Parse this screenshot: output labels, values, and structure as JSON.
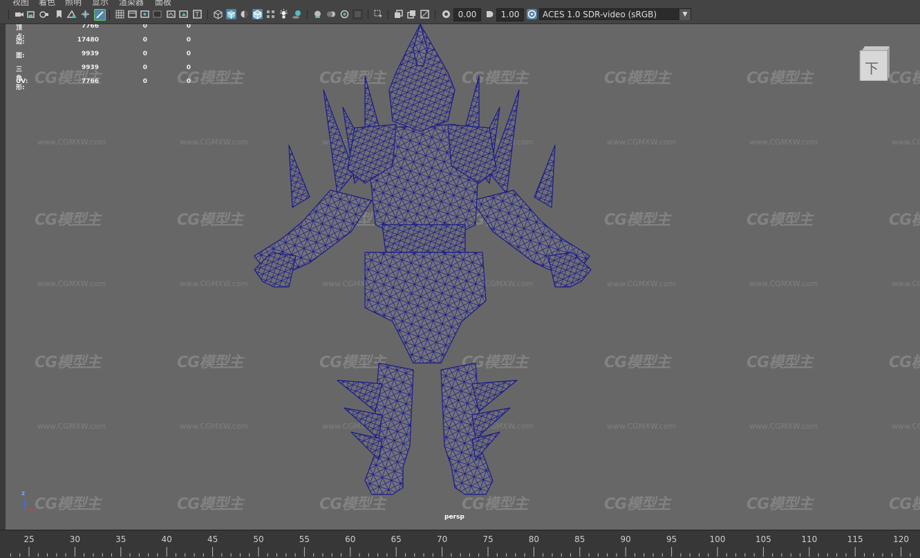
{
  "menu": {
    "items": [
      "视图",
      "着色",
      "照明",
      "显示",
      "渲染器",
      "面板"
    ]
  },
  "toolbar": {
    "exposure_value": "0.00",
    "gamma_value": "1.00",
    "color_space": "ACES 1.0 SDR-video (sRGB)"
  },
  "hud": {
    "rows": [
      {
        "label": "顶点:",
        "v1": "7766",
        "v2": "0",
        "v3": "0"
      },
      {
        "label": "边:",
        "v1": "17480",
        "v2": "0",
        "v3": "0"
      },
      {
        "label": "面:",
        "v1": "9939",
        "v2": "0",
        "v3": "0"
      },
      {
        "label": "三角形:",
        "v1": "9939",
        "v2": "0",
        "v3": "0"
      },
      {
        "label": "UV:",
        "v1": "7766",
        "v2": "0",
        "v3": "0"
      }
    ]
  },
  "viewcube": {
    "label": "下"
  },
  "viewport": {
    "camera": "persp",
    "axis_label": "Z"
  },
  "watermark": {
    "logo": "CG模型主",
    "url": "www.CGMXW.com"
  },
  "timeline": {
    "ticks": [
      "25",
      "30",
      "35",
      "40",
      "45",
      "50",
      "55",
      "60",
      "65",
      "70",
      "75",
      "80",
      "85",
      "90",
      "95",
      "100",
      "105",
      "110",
      "115",
      "120"
    ]
  },
  "colors": {
    "viewport_bg": "#676767",
    "wireframe": "#1a1a8c",
    "mesh_fill": "#707075",
    "accent": "#5285a6"
  }
}
